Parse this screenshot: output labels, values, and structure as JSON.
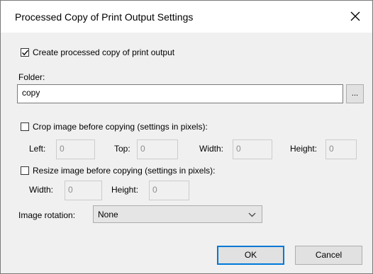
{
  "dialog": {
    "title": "Processed Copy of Print Output Settings",
    "close_label": "×"
  },
  "create_copy": {
    "label": "Create processed copy of print output",
    "checked": true
  },
  "folder": {
    "label": "Folder:",
    "value": "copy",
    "browse_label": "..."
  },
  "crop": {
    "label": "Crop image before copying (settings in pixels):",
    "checked": false,
    "left_label": "Left:",
    "left_value": "0",
    "top_label": "Top:",
    "top_value": "0",
    "width_label": "Width:",
    "width_value": "0",
    "height_label": "Height:",
    "height_value": "0"
  },
  "resize": {
    "label": "Resize image before copying (settings in pixels):",
    "checked": false,
    "width_label": "Width:",
    "width_value": "0",
    "height_label": "Height:",
    "height_value": "0"
  },
  "rotation": {
    "label": "Image rotation:",
    "selected": "None"
  },
  "buttons": {
    "ok": "OK",
    "cancel": "Cancel"
  },
  "colors": {
    "accent": "#0078d7",
    "dialog_bg": "#f0f0f0",
    "disabled_text": "#8c8c8c"
  }
}
